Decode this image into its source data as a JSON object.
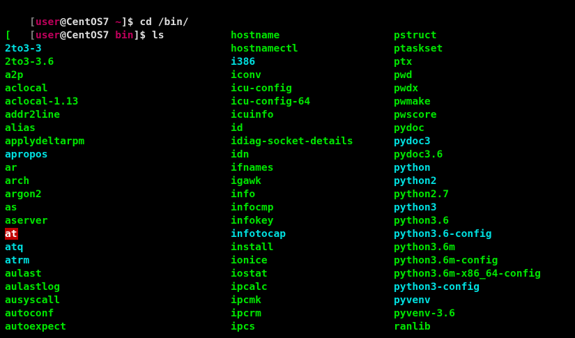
{
  "prompt1": {
    "open": "[",
    "user": "user",
    "at_host": "@CentOS7",
    "dir": "~",
    "close": "]$",
    "command": "cd /bin/"
  },
  "prompt2": {
    "open": "[",
    "user": "user",
    "at_host": "@CentOS7",
    "dir": "bin",
    "close": "]$",
    "command": "ls"
  },
  "colors": {
    "executable": "#00e600",
    "symlink": "#00e0e0",
    "highlight_bg": "#c00000",
    "prompt_user": "#c0005c",
    "background": "#000000"
  },
  "listing": {
    "columns": [
      [
        {
          "name": "[",
          "type": "exec"
        },
        {
          "name": "2to3-3",
          "type": "link"
        },
        {
          "name": "2to3-3.6",
          "type": "exec"
        },
        {
          "name": "a2p",
          "type": "exec"
        },
        {
          "name": "aclocal",
          "type": "exec"
        },
        {
          "name": "aclocal-1.13",
          "type": "exec"
        },
        {
          "name": "addr2line",
          "type": "exec"
        },
        {
          "name": "alias",
          "type": "exec"
        },
        {
          "name": "applydeltarpm",
          "type": "exec"
        },
        {
          "name": "apropos",
          "type": "link"
        },
        {
          "name": "ar",
          "type": "exec"
        },
        {
          "name": "arch",
          "type": "exec"
        },
        {
          "name": "argon2",
          "type": "exec"
        },
        {
          "name": "as",
          "type": "exec"
        },
        {
          "name": "aserver",
          "type": "exec"
        },
        {
          "name": "at",
          "type": "highlight"
        },
        {
          "name": "atq",
          "type": "link"
        },
        {
          "name": "atrm",
          "type": "link"
        },
        {
          "name": "aulast",
          "type": "exec"
        },
        {
          "name": "aulastlog",
          "type": "exec"
        },
        {
          "name": "ausyscall",
          "type": "exec"
        },
        {
          "name": "autoconf",
          "type": "exec"
        },
        {
          "name": "autoexpect",
          "type": "exec"
        }
      ],
      [
        {
          "name": "hostname",
          "type": "exec"
        },
        {
          "name": "hostnamectl",
          "type": "exec"
        },
        {
          "name": "i386",
          "type": "link"
        },
        {
          "name": "iconv",
          "type": "exec"
        },
        {
          "name": "icu-config",
          "type": "exec"
        },
        {
          "name": "icu-config-64",
          "type": "exec"
        },
        {
          "name": "icuinfo",
          "type": "exec"
        },
        {
          "name": "id",
          "type": "exec"
        },
        {
          "name": "idiag-socket-details",
          "type": "exec"
        },
        {
          "name": "idn",
          "type": "exec"
        },
        {
          "name": "ifnames",
          "type": "exec"
        },
        {
          "name": "igawk",
          "type": "exec"
        },
        {
          "name": "info",
          "type": "exec"
        },
        {
          "name": "infocmp",
          "type": "exec"
        },
        {
          "name": "infokey",
          "type": "exec"
        },
        {
          "name": "infotocap",
          "type": "link"
        },
        {
          "name": "install",
          "type": "exec"
        },
        {
          "name": "ionice",
          "type": "exec"
        },
        {
          "name": "iostat",
          "type": "exec"
        },
        {
          "name": "ipcalc",
          "type": "exec"
        },
        {
          "name": "ipcmk",
          "type": "exec"
        },
        {
          "name": "ipcrm",
          "type": "exec"
        },
        {
          "name": "ipcs",
          "type": "exec"
        }
      ],
      [
        {
          "name": "pstruct",
          "type": "exec"
        },
        {
          "name": "ptaskset",
          "type": "exec"
        },
        {
          "name": "ptx",
          "type": "exec"
        },
        {
          "name": "pwd",
          "type": "exec"
        },
        {
          "name": "pwdx",
          "type": "exec"
        },
        {
          "name": "pwmake",
          "type": "exec"
        },
        {
          "name": "pwscore",
          "type": "exec"
        },
        {
          "name": "pydoc",
          "type": "exec"
        },
        {
          "name": "pydoc3",
          "type": "link"
        },
        {
          "name": "pydoc3.6",
          "type": "exec"
        },
        {
          "name": "python",
          "type": "link"
        },
        {
          "name": "python2",
          "type": "link"
        },
        {
          "name": "python2.7",
          "type": "exec"
        },
        {
          "name": "python3",
          "type": "link"
        },
        {
          "name": "python3.6",
          "type": "exec"
        },
        {
          "name": "python3.6-config",
          "type": "link"
        },
        {
          "name": "python3.6m",
          "type": "exec"
        },
        {
          "name": "python3.6m-config",
          "type": "exec"
        },
        {
          "name": "python3.6m-x86_64-config",
          "type": "exec"
        },
        {
          "name": "python3-config",
          "type": "link"
        },
        {
          "name": "pyvenv",
          "type": "link"
        },
        {
          "name": "pyvenv-3.6",
          "type": "exec"
        },
        {
          "name": "ranlib",
          "type": "exec"
        }
      ]
    ]
  }
}
